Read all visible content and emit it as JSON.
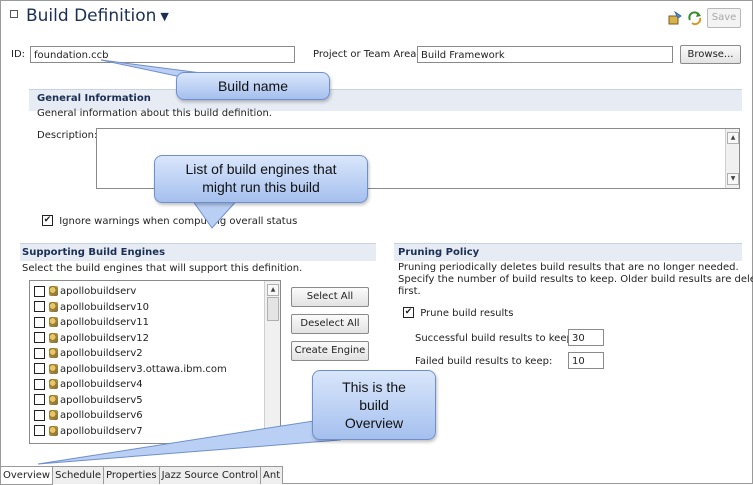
{
  "header": {
    "title": "Build Definition",
    "save_label": "Save"
  },
  "id_field": {
    "label": "ID:",
    "value": "foundation.ccb"
  },
  "project_field": {
    "label": "Project or Team Area:",
    "value": "Build Framework",
    "browse_label": "Browse..."
  },
  "general": {
    "title": "General Information",
    "desc": "General information about this build definition.",
    "description_label": "Description:",
    "ignore_warnings": {
      "label": "Ignore warnings when computing overall status",
      "checked": true
    }
  },
  "engines": {
    "title": "Supporting Build Engines",
    "desc": "Select the build engines that will support this definition.",
    "items": [
      "apollobuildserv",
      "apollobuildserv10",
      "apollobuildserv11",
      "apollobuildserv12",
      "apollobuildserv2",
      "apollobuildserv3.ottawa.ibm.com",
      "apollobuildserv4",
      "apollobuildserv5",
      "apollobuildserv6",
      "apollobuildserv7"
    ],
    "select_all": "Select All",
    "deselect_all": "Deselect All",
    "create_engine": "Create Engine"
  },
  "pruning": {
    "title": "Pruning Policy",
    "desc_lines": [
      "Pruning periodically deletes build results that are no longer needed.",
      "Specify the number of build results to keep. Older build results are deleted",
      "first."
    ],
    "prune_label": "Prune build results",
    "prune_checked": true,
    "successful_label": "Successful build results to keep:",
    "successful_value": "30",
    "failed_label": "Failed build results to keep:",
    "failed_value": "10"
  },
  "callouts": {
    "build_name": "Build name",
    "engines_line1": "List of build engines that",
    "engines_line2": "might run this build",
    "overview_line1": "This is the",
    "overview_line2": "build",
    "overview_line3": "Overview"
  },
  "tabs": [
    "Overview",
    "Schedule",
    "Properties",
    "Jazz Source Control",
    "Ant"
  ],
  "colors": {
    "title": "#1b2f55",
    "section_bg": "#e6ebf4",
    "callout_fill": "#b9cff3",
    "callout_line": "#6f8fcc"
  },
  "icons": [
    "bullet-square-icon",
    "chevron-down-icon",
    "build-request-icon",
    "refresh-icon",
    "scroll-up-icon",
    "scroll-down-icon",
    "engine-icon",
    "checkmark-icon"
  ]
}
